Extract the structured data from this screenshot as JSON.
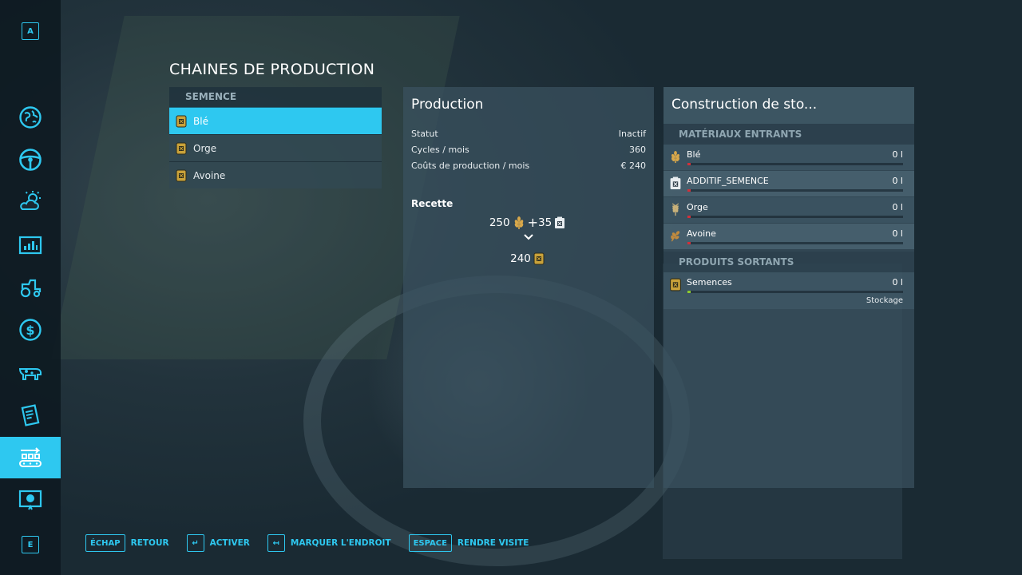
{
  "sidebar": {
    "top_key": "A",
    "bottom_key": "E",
    "items": [
      {
        "icon": "map-globe-icon"
      },
      {
        "icon": "steering-wheel-icon"
      },
      {
        "icon": "weather-icon"
      },
      {
        "icon": "prices-chart-icon"
      },
      {
        "icon": "vehicles-tractor-icon"
      },
      {
        "icon": "finances-dollar-icon"
      },
      {
        "icon": "animals-icon"
      },
      {
        "icon": "contracts-icon"
      },
      {
        "icon": "production-chains-icon",
        "active": true
      },
      {
        "icon": "help-tips-icon"
      }
    ],
    "accent": "#2ec8f0"
  },
  "page": {
    "title": "CHAINES DE PRODUCTION"
  },
  "chains": {
    "header": "SEMENCE",
    "items": [
      {
        "label": "Blé",
        "selected": true
      },
      {
        "label": "Orge"
      },
      {
        "label": "Avoine"
      }
    ]
  },
  "production": {
    "title": "Production",
    "stats": [
      {
        "label": "Statut",
        "value": "Inactif"
      },
      {
        "label": "Cycles / mois",
        "value": "360"
      },
      {
        "label": "Coûts de production / mois",
        "value": "€ 240"
      }
    ],
    "recipe_title": "Recette",
    "recipe": {
      "input1_amount": "250",
      "plus": "+",
      "input2_amount": "35",
      "output_amount": "240"
    }
  },
  "storage": {
    "title": "Construction de sto...",
    "inputs_label": "MATÉRIAUX ENTRANTS",
    "inputs": [
      {
        "name": "Blé",
        "amount": "0 l",
        "icon": "wheat-icon"
      },
      {
        "name": "ADDITIF_SEMENCE",
        "amount": "0 l",
        "icon": "additive-icon"
      },
      {
        "name": "Orge",
        "amount": "0 l",
        "icon": "barley-icon"
      },
      {
        "name": "Avoine",
        "amount": "0 l",
        "icon": "oat-icon"
      }
    ],
    "outputs_label": "PRODUITS SORTANTS",
    "outputs": [
      {
        "name": "Semences",
        "amount": "0 l",
        "mode": "Stockage",
        "icon": "seeds-icon"
      }
    ]
  },
  "bottom_bar": {
    "hints": [
      {
        "key": "ÉCHAP",
        "label": "RETOUR"
      },
      {
        "key": "↵",
        "label": "ACTIVER"
      },
      {
        "key": "↤",
        "label": "MARQUER L'ENDROIT"
      },
      {
        "key": "ESPACE",
        "label": "RENDRE VISITE"
      }
    ]
  }
}
